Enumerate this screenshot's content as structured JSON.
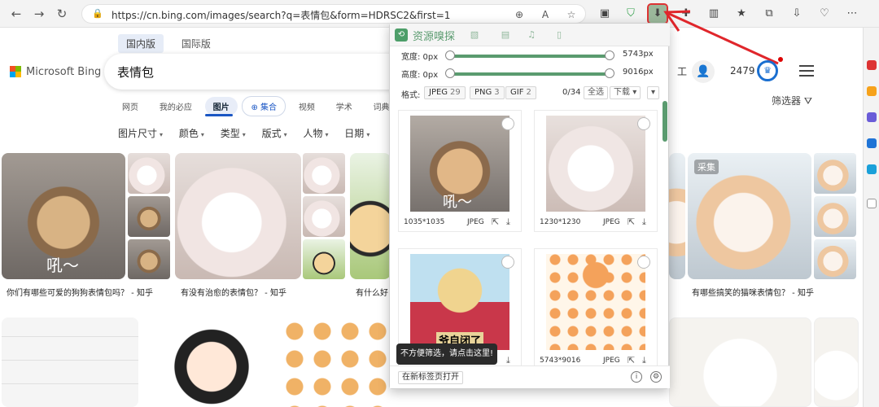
{
  "browser": {
    "url": "https://cn.bing.com/images/search?q=表情包&form=HDRSC2&first=1"
  },
  "bing": {
    "region_tabs": [
      "国内版",
      "国际版"
    ],
    "logo_text": "Microsoft Bing",
    "query": "表情包",
    "work_label": "工",
    "points": "2479",
    "vertical_tabs": [
      "网页",
      "我的必应",
      "图片",
      "集合",
      "视频",
      "学术",
      "词典"
    ],
    "filter_label": "筛选器",
    "filters": [
      "图片尺寸",
      "颜色",
      "类型",
      "版式",
      "人物",
      "日期"
    ],
    "captions": [
      "你们有哪些可爱的狗狗表情包吗？ - 知乎",
      "有没有治愈的表情包？ - 知乎",
      "有什么好",
      "有哪些搞笑的猫咪表情包？ - 知乎"
    ],
    "collect_label": "采集",
    "dog_caption_overlay": "吼～"
  },
  "popup": {
    "title": "资源嗅探",
    "width_label": "宽度: 0px",
    "width_max": "5743px",
    "height_label": "高度: 0px",
    "height_max": "9016px",
    "format_label": "格式:",
    "formats": [
      {
        "name": "JPEG",
        "count": "29"
      },
      {
        "name": "PNG",
        "count": "3"
      },
      {
        "name": "GIF",
        "count": "2"
      }
    ],
    "selection_count": "0/34",
    "select_all": "全选",
    "download": "下载",
    "cards": [
      {
        "dims": "1035*1035",
        "type": "JPEG",
        "overlay": "吼～"
      },
      {
        "dims": "1230*1230",
        "type": "JPEG",
        "overlay": ""
      },
      {
        "dims": "",
        "type": "",
        "overlay": "爷自闭了"
      },
      {
        "dims": "5743*9016",
        "type": "JPEG",
        "overlay": ""
      }
    ],
    "open_tab": "在新标签页打开",
    "tooltip": "不方便筛选，请点击这里!"
  }
}
